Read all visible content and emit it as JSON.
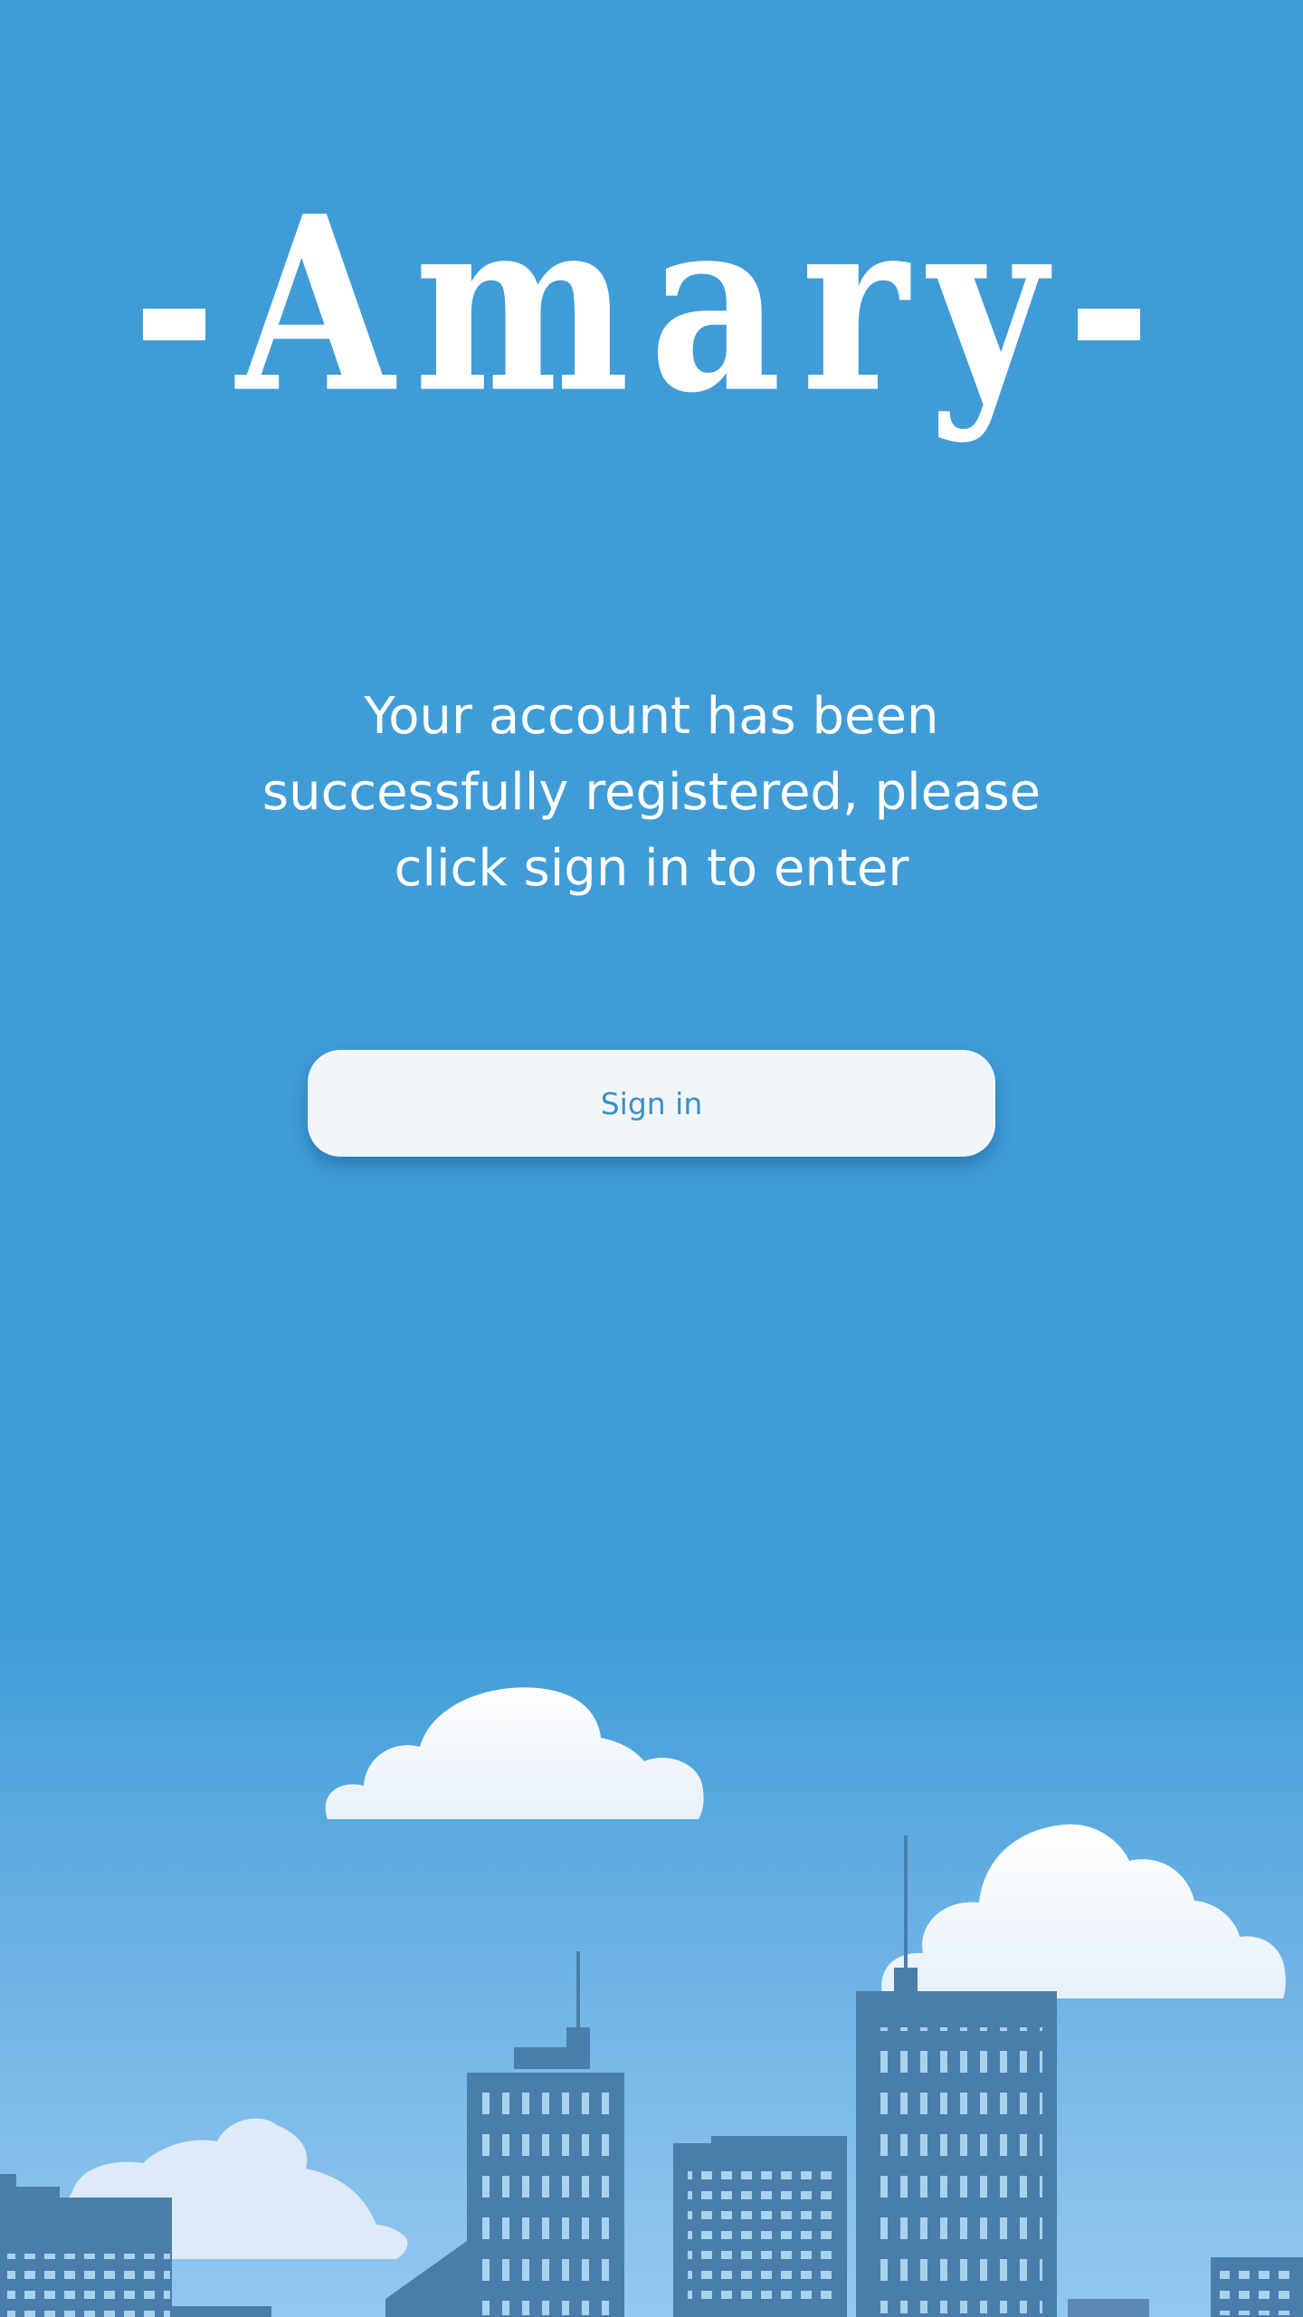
{
  "app": {
    "logo_text": "-Amary-"
  },
  "main": {
    "message": "Your account has been successfully registered, please click sign in to enter",
    "signin_label": "Sign in"
  },
  "colors": {
    "background": "#3f9cd7",
    "button_bg": "#f1f6fb",
    "button_text": "#3a8fc8",
    "building": "#4a7eaa",
    "cloud": "#f4f8fc",
    "window": "#a9d2ef"
  },
  "decor": {
    "illustration": "city-skyline-with-clouds"
  }
}
